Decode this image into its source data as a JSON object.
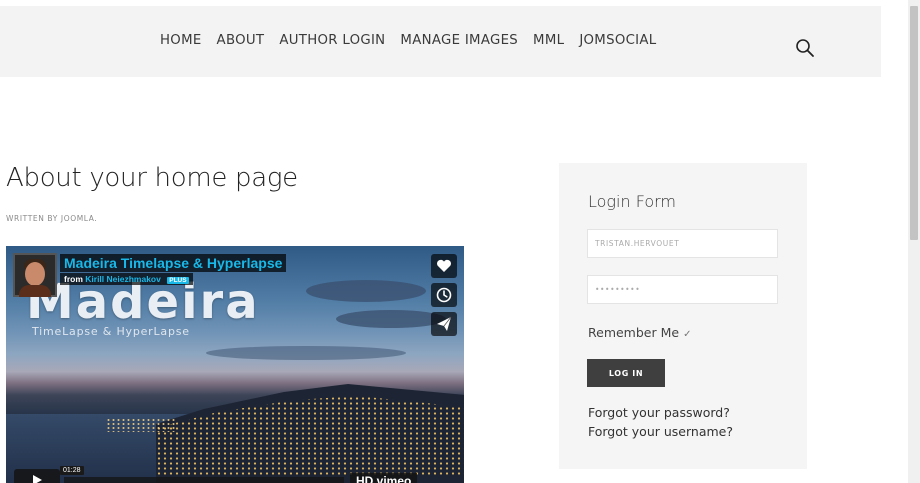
{
  "nav": {
    "items": [
      {
        "label": "HOME"
      },
      {
        "label": "ABOUT"
      },
      {
        "label": "AUTHOR LOGIN"
      },
      {
        "label": "MANAGE IMAGES"
      },
      {
        "label": "MML"
      },
      {
        "label": "JOMSOCIAL"
      }
    ],
    "search_icon": "search-icon"
  },
  "article": {
    "title": "About your home page",
    "byline": "WRITTEN BY JOOMLA."
  },
  "video": {
    "title": "Madeira Timelapse & Hyperlapse",
    "from_label": "from",
    "author": "Kirill Neiezhmakov",
    "author_badge": "PLUS",
    "overlay_word": "Madeira",
    "overlay_subtitle": "TimeLapse & HyperLapse",
    "duration": "01:28",
    "brand_text": "HD vimeo",
    "side_icons": [
      "heart-icon",
      "clock-icon",
      "paper-plane-icon"
    ]
  },
  "login": {
    "title": "Login Form",
    "username_value": "TRISTAN.HERVOUET",
    "password_value": "•••••••••",
    "remember_label": "Remember Me",
    "remember_check": "✓",
    "login_button": "LOG IN",
    "forgot_password": "Forgot your password?",
    "forgot_username": "Forgot your username?"
  }
}
